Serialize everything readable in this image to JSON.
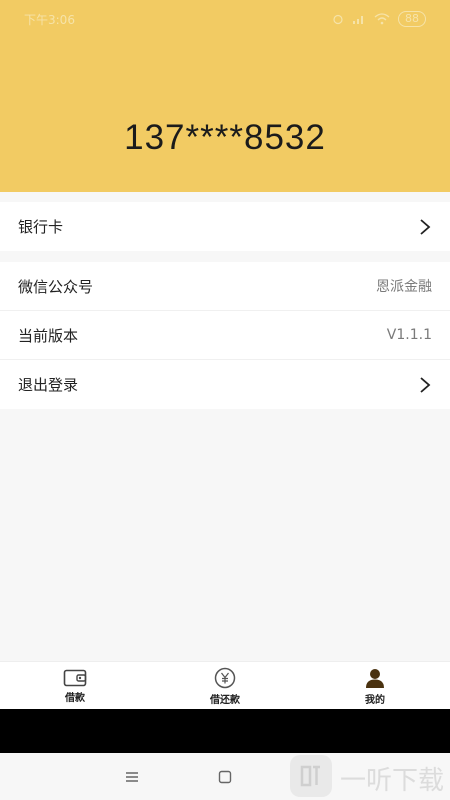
{
  "status_bar": {
    "time": "下午3:06",
    "battery": "88"
  },
  "profile": {
    "phone": "137****8532"
  },
  "menu": {
    "bank_card": "银行卡",
    "wechat_label": "微信公众号",
    "wechat_value": "恩派金融",
    "version_label": "当前版本",
    "version_value": "V1.1.1",
    "logout": "退出登录"
  },
  "tabs": [
    {
      "label": "借款",
      "icon": "wallet-icon"
    },
    {
      "label": "借还款",
      "icon": "yuan-coin-icon"
    },
    {
      "label": "我的",
      "icon": "user-icon"
    }
  ],
  "watermark": {
    "text": "一听下载"
  },
  "colors": {
    "header": "#f2cb63",
    "background": "#f7f7f7",
    "text": "#222222",
    "secondary": "#7a7a7a"
  }
}
